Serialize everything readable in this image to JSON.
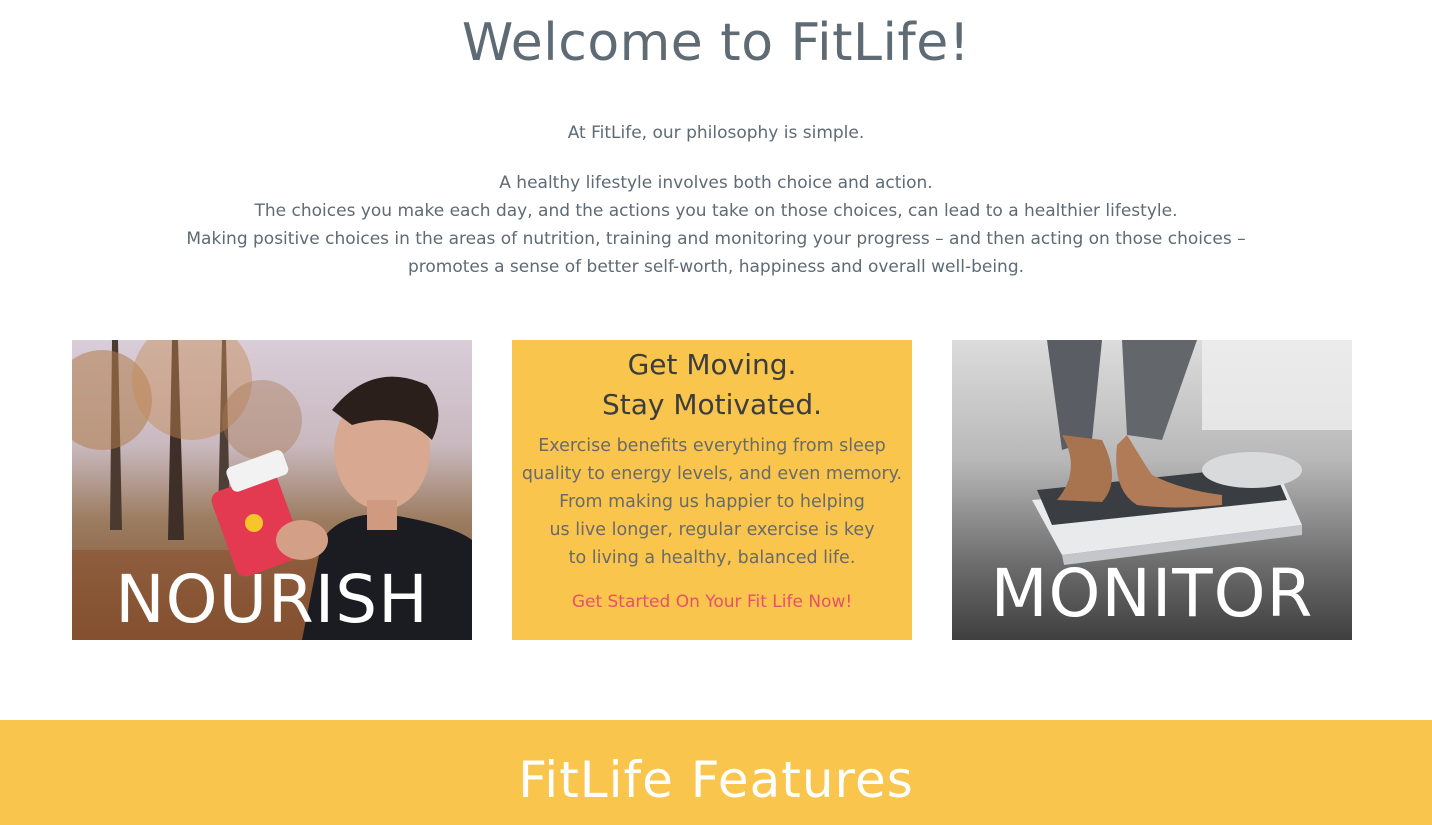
{
  "header": {
    "title": "Welcome to FitLife!"
  },
  "intro": {
    "philosophy": "At FitLife, our philosophy is simple.",
    "lines": [
      "A healthy lifestyle involves both choice and action.",
      "The choices you make each day, and the actions you take on those choices, can lead to a healthier lifestyle.",
      "Making positive choices in the areas of nutrition, training and monitoring your progress – and then acting on those choices –",
      "promotes a sense of better self-worth, happiness and overall well-being."
    ]
  },
  "cards": {
    "nourish": {
      "label": "NOURISH"
    },
    "middle": {
      "heading_line1": "Get Moving.",
      "heading_line2": "Stay Motivated.",
      "body_lines": [
        "Exercise benefits everything from sleep",
        "quality to energy levels, and even memory.",
        "From making us happier to helping",
        "us live longer, regular exercise is key",
        "to living a healthy, balanced life."
      ],
      "cta_link": "Get Started On Your Fit Life Now!"
    },
    "monitor": {
      "label": "MONITOR"
    }
  },
  "features": {
    "title": "FitLife Features"
  },
  "colors": {
    "accent_yellow": "#f9c54c",
    "text_gray": "#5e6a74",
    "link_pink": "#e4516b"
  }
}
